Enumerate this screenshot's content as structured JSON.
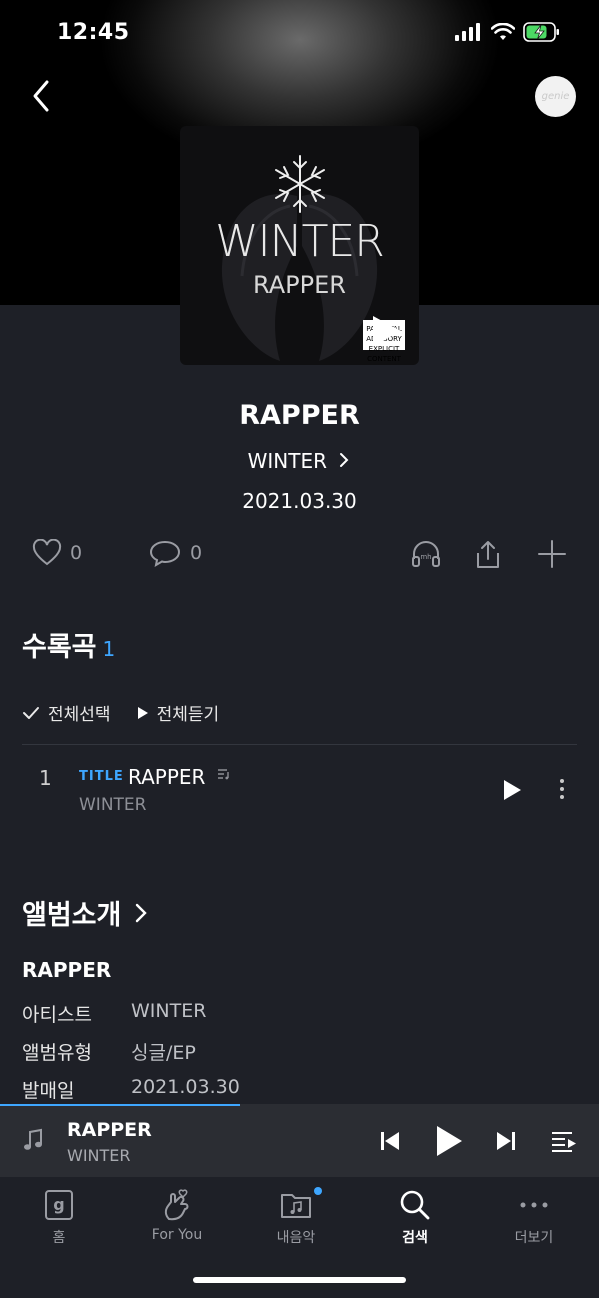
{
  "status": {
    "time": "12:45"
  },
  "header": {
    "avatar_text": "genie"
  },
  "cover": {
    "line1": "WINTER",
    "line2": "RAPPER",
    "advisory": "PARENTAL ADVISORY EXPLICIT CONTENT"
  },
  "album": {
    "title": "RAPPER",
    "artist": "WINTER",
    "date": "2021.03.30"
  },
  "actions": {
    "likes": "0",
    "comments": "0"
  },
  "tracklist": {
    "heading": "수록곡",
    "count": "1",
    "select_all": "전체선택",
    "play_all": "전체듣기",
    "tracks": [
      {
        "num": "1",
        "badge": "TITLE",
        "title": "RAPPER",
        "artist": "WINTER"
      }
    ]
  },
  "intro": {
    "heading": "앨범소개",
    "album_name": "RAPPER",
    "rows": [
      {
        "label": "아티스트",
        "value": "WINTER"
      },
      {
        "label": "앨범유형",
        "value": "싱글/EP"
      },
      {
        "label": "발매일",
        "value": "2021.03.30"
      }
    ]
  },
  "mini_player": {
    "title": "RAPPER",
    "artist": "WINTER",
    "progress": 0.4
  },
  "tabs": [
    {
      "label": "홈",
      "icon": "home-g-icon"
    },
    {
      "label": "For You",
      "icon": "hand-heart-icon"
    },
    {
      "label": "내음악",
      "icon": "music-folder-icon"
    },
    {
      "label": "검색",
      "icon": "search-icon"
    },
    {
      "label": "더보기",
      "icon": "more-icon"
    }
  ],
  "colors": {
    "accent": "#3ea6ff",
    "background": "#1e2027"
  }
}
